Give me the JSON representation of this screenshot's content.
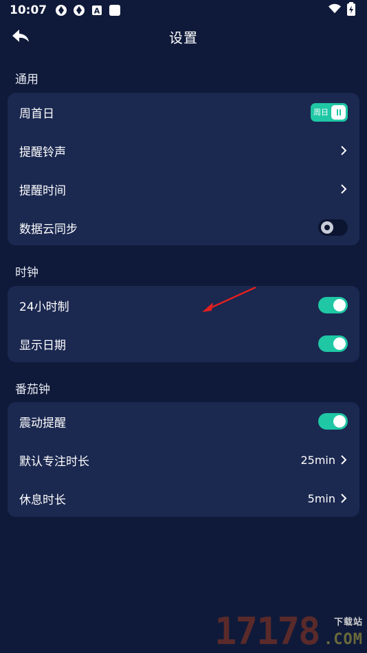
{
  "status_bar": {
    "time": "10:07",
    "left_icons": [
      "aperture-icon",
      "aperture-icon",
      "a-badge-icon",
      "square-icon"
    ],
    "right_icons": [
      "wifi-icon",
      "battery-charging-icon"
    ]
  },
  "header": {
    "title": "设置",
    "back_icon": "back-arrow-icon"
  },
  "sections": {
    "general": {
      "title": "通用",
      "week_start": {
        "label": "周首日",
        "toggle_text": "周日"
      },
      "reminder_sound": {
        "label": "提醒铃声"
      },
      "reminder_time": {
        "label": "提醒时间"
      },
      "cloud_sync": {
        "label": "数据云同步",
        "state": "off"
      }
    },
    "clock": {
      "title": "时钟",
      "hour24": {
        "label": "24小时制",
        "state": "on"
      },
      "show_date": {
        "label": "显示日期",
        "state": "on"
      }
    },
    "pomodoro": {
      "title": "番茄钟",
      "vibrate": {
        "label": "震动提醒",
        "state": "on"
      },
      "focus_duration": {
        "label": "默认专注时长",
        "value": "25min"
      },
      "break_duration": {
        "label": "休息时长",
        "value": "5min"
      }
    }
  },
  "colors": {
    "background": "#0f1a3a",
    "card": "#1b2850",
    "accent": "#1fc7a4",
    "annotation_arrow": "#e0201f"
  },
  "watermark": {
    "digits": "17178",
    "tag": "下载站",
    "domain": ".COM"
  }
}
